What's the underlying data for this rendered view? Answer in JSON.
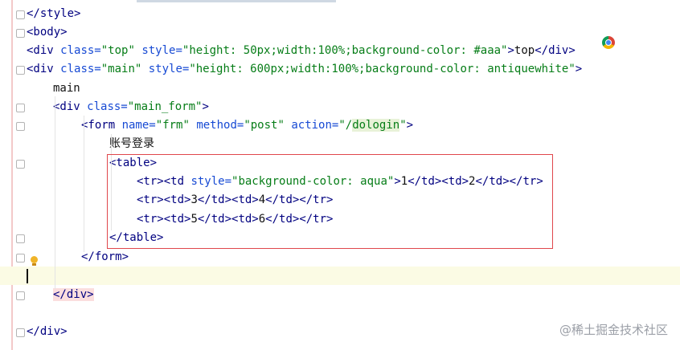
{
  "editor": {
    "lines": [
      {
        "tokens": [
          [
            "tag",
            "</style>"
          ]
        ]
      },
      {
        "tokens": [
          [
            "tag",
            "<body>"
          ]
        ]
      },
      {
        "tokens": [
          [
            "tag",
            "<div "
          ],
          [
            "attr",
            "class="
          ],
          [
            "val",
            "\"top\""
          ],
          [
            "attr",
            " style="
          ],
          [
            "val",
            "\"height: 50px;width:100%;background-color: #aaa\""
          ],
          [
            "tag",
            ">"
          ],
          [
            "txt",
            "top"
          ],
          [
            "tag",
            "</div>"
          ]
        ]
      },
      {
        "tokens": [
          [
            "tag",
            "<div "
          ],
          [
            "attr",
            "class="
          ],
          [
            "val",
            "\"main\""
          ],
          [
            "attr",
            " style="
          ],
          [
            "val",
            "\"height: 600px;width:100%;background-color: antiquewhite\""
          ],
          [
            "tag",
            ">"
          ]
        ]
      },
      {
        "tokens": [
          [
            "txt",
            "main"
          ]
        ]
      },
      {
        "tokens": [
          [
            "tag",
            "<div "
          ],
          [
            "attr",
            "class="
          ],
          [
            "val",
            "\"main_form\""
          ],
          [
            "tag",
            ">"
          ]
        ]
      },
      {
        "tokens": [
          [
            "tag",
            "<form "
          ],
          [
            "attr",
            "name="
          ],
          [
            "val",
            "\"frm\""
          ],
          [
            "attr",
            " method="
          ],
          [
            "val",
            "\"post\""
          ],
          [
            "attr",
            " action="
          ],
          [
            "val",
            "\"/"
          ],
          [
            "val-green",
            "dologin"
          ],
          [
            "val",
            "\""
          ],
          [
            "tag",
            ">"
          ]
        ]
      },
      {
        "tokens": [
          [
            "txt",
            "账号登录"
          ]
        ]
      },
      {
        "tokens": [
          [
            "tag",
            "<table>"
          ]
        ]
      },
      {
        "tokens": [
          [
            "tag",
            "<tr><td "
          ],
          [
            "attr",
            "style="
          ],
          [
            "val",
            "\"background-color: aqua\""
          ],
          [
            "tag",
            ">"
          ],
          [
            "txt",
            "1"
          ],
          [
            "tag",
            "</td><td>"
          ],
          [
            "txt",
            "2"
          ],
          [
            "tag",
            "</td></tr>"
          ]
        ]
      },
      {
        "tokens": [
          [
            "tag",
            "<tr><td>"
          ],
          [
            "txt",
            "3"
          ],
          [
            "tag",
            "</td><td>"
          ],
          [
            "txt",
            "4"
          ],
          [
            "tag",
            "</td></tr>"
          ]
        ]
      },
      {
        "tokens": [
          [
            "tag",
            "<tr><td>"
          ],
          [
            "txt",
            "5"
          ],
          [
            "tag",
            "</td><td>"
          ],
          [
            "txt",
            "6"
          ],
          [
            "tag",
            "</td></tr>"
          ]
        ]
      },
      {
        "tokens": [
          [
            "tag",
            "</table>"
          ]
        ]
      },
      {
        "tokens": [
          [
            "tag",
            "</form>"
          ]
        ]
      },
      {
        "tokens": []
      },
      {
        "tokens": [
          [
            "tag-red",
            "</div>"
          ]
        ]
      },
      {
        "tokens": []
      },
      {
        "tokens": [
          [
            "tag",
            "</div>"
          ]
        ]
      }
    ]
  },
  "gutter_icons": {
    "browser": "chrome-icon",
    "intention": "bulb-icon"
  },
  "watermark": "@稀土掘金技术社区",
  "colors": {
    "tag": "#000080",
    "attribute": "#174ad4",
    "string": "#067d17",
    "highlight_box": "#e0474c"
  }
}
